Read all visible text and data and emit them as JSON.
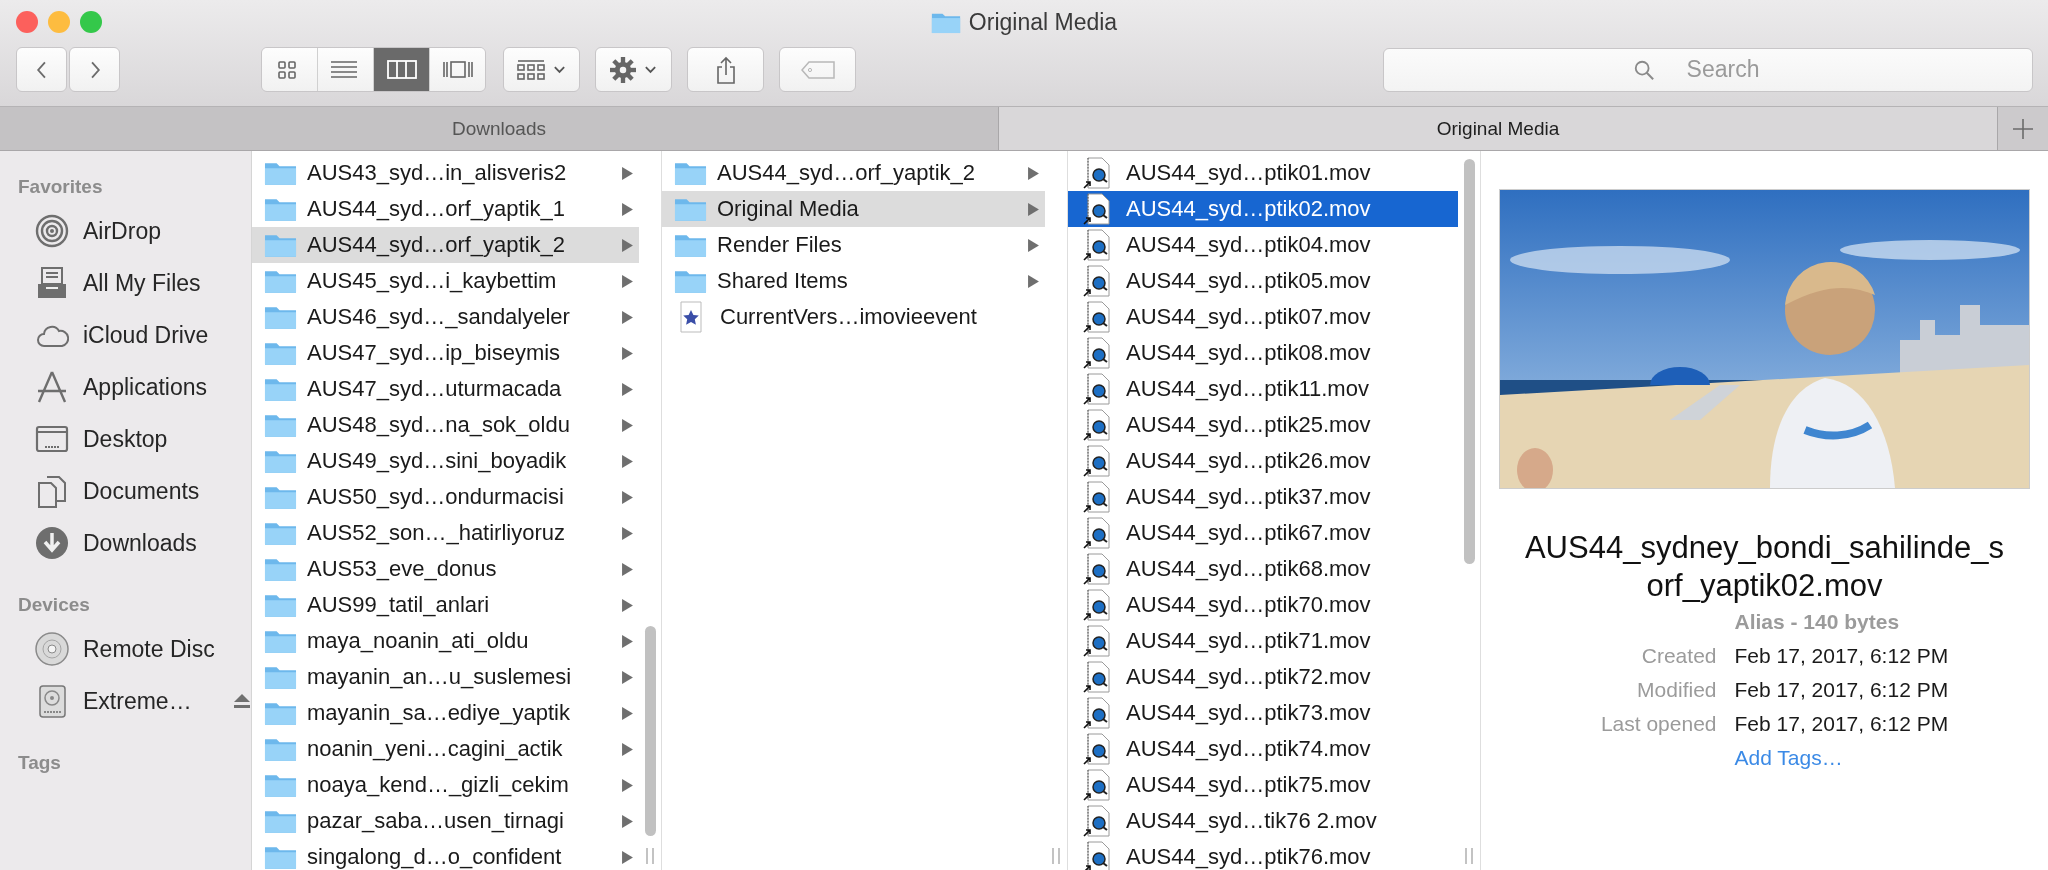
{
  "window": {
    "title": "Original Media"
  },
  "toolbar": {
    "navigation": [
      {
        "kind": "back"
      },
      {
        "kind": "forward"
      }
    ],
    "view_modes": [
      {
        "kind": "icons",
        "selected": false
      },
      {
        "kind": "list",
        "selected": false
      },
      {
        "kind": "columns",
        "selected": true
      },
      {
        "kind": "gallery",
        "selected": false
      }
    ],
    "buttons": [
      {
        "kind": "arrange",
        "disabled": false
      },
      {
        "kind": "action",
        "disabled": false
      },
      {
        "kind": "share",
        "disabled": false
      },
      {
        "kind": "tags",
        "disabled": true
      }
    ]
  },
  "search": {
    "placeholder": "Search"
  },
  "tabs": [
    {
      "label": "Downloads",
      "selected": false
    },
    {
      "label": "Original Media",
      "selected": true
    }
  ],
  "sidebar": {
    "sections": [
      {
        "heading": "Favorites",
        "items": [
          {
            "label": "AirDrop",
            "kind": "airdrop"
          },
          {
            "label": "All My Files",
            "kind": "files"
          },
          {
            "label": "iCloud Drive",
            "kind": "cloud"
          },
          {
            "label": "Applications",
            "kind": "applications"
          },
          {
            "label": "Desktop",
            "kind": "desktop"
          },
          {
            "label": "Documents",
            "kind": "documents"
          },
          {
            "label": "Downloads",
            "kind": "downloads"
          }
        ]
      },
      {
        "heading": "Devices",
        "items": [
          {
            "label": "Remote Disc",
            "kind": "disc",
            "eject": false
          },
          {
            "label": "Extreme…",
            "kind": "drive",
            "eject": true
          }
        ]
      },
      {
        "heading": "Tags"
      }
    ]
  },
  "columns": [
    {
      "focused": false,
      "items": [
        {
          "name": "AUS43_syd…in_alisveris2",
          "kind": "folder",
          "selected": false
        },
        {
          "name": "AUS44_syd…orf_yaptik_1",
          "kind": "folder",
          "selected": false
        },
        {
          "name": "AUS44_syd…orf_yaptik_2",
          "kind": "folder",
          "selected": true
        },
        {
          "name": "AUS45_syd…i_kaybettim",
          "kind": "folder",
          "selected": false
        },
        {
          "name": "AUS46_syd…_sandalyeler",
          "kind": "folder",
          "selected": false
        },
        {
          "name": "AUS47_syd…ip_biseymis",
          "kind": "folder",
          "selected": false
        },
        {
          "name": "AUS47_syd…uturmacada",
          "kind": "folder",
          "selected": false
        },
        {
          "name": "AUS48_syd…na_sok_oldu",
          "kind": "folder",
          "selected": false
        },
        {
          "name": "AUS49_syd…sini_boyadik",
          "kind": "folder",
          "selected": false
        },
        {
          "name": "AUS50_syd…ondurmacisi",
          "kind": "folder",
          "selected": false
        },
        {
          "name": "AUS52_son…_hatirliyoruz",
          "kind": "folder",
          "selected": false
        },
        {
          "name": "AUS53_eve_donus",
          "kind": "folder",
          "selected": false
        },
        {
          "name": "AUS99_tatil_anlari",
          "kind": "folder",
          "selected": false
        },
        {
          "name": "maya_noanin_ati_oldu",
          "kind": "folder",
          "selected": false
        },
        {
          "name": "mayanin_an…u_suslemesi",
          "kind": "folder",
          "selected": false
        },
        {
          "name": "mayanin_sa…ediye_yaptik",
          "kind": "folder",
          "selected": false
        },
        {
          "name": "noanin_yeni…cagini_actik",
          "kind": "folder",
          "selected": false
        },
        {
          "name": "noaya_kend…_gizli_cekim",
          "kind": "folder",
          "selected": false
        },
        {
          "name": "pazar_saba…usen_tirnagi",
          "kind": "folder",
          "selected": false
        },
        {
          "name": "singalong_d…o_confident",
          "kind": "folder",
          "selected": false
        }
      ]
    },
    {
      "focused": false,
      "items": [
        {
          "name": "AUS44_syd…orf_yaptik_2",
          "kind": "folder",
          "selected": false
        },
        {
          "name": "Original Media",
          "kind": "folder",
          "selected": true
        },
        {
          "name": "Render Files",
          "kind": "folder",
          "selected": false
        },
        {
          "name": "Shared Items",
          "kind": "folder",
          "selected": false
        },
        {
          "name": "CurrentVers…imovieevent",
          "kind": "event",
          "selected": false
        }
      ]
    },
    {
      "focused": true,
      "items": [
        {
          "name": "AUS44_syd…ptik01.mov",
          "kind": "movie",
          "selected": false
        },
        {
          "name": "AUS44_syd…ptik02.mov",
          "kind": "movie",
          "selected": true
        },
        {
          "name": "AUS44_syd…ptik04.mov",
          "kind": "movie",
          "selected": false
        },
        {
          "name": "AUS44_syd…ptik05.mov",
          "kind": "movie",
          "selected": false
        },
        {
          "name": "AUS44_syd…ptik07.mov",
          "kind": "movie",
          "selected": false
        },
        {
          "name": "AUS44_syd…ptik08.mov",
          "kind": "movie",
          "selected": false
        },
        {
          "name": "AUS44_syd…ptik11.mov",
          "kind": "movie",
          "selected": false
        },
        {
          "name": "AUS44_syd…ptik25.mov",
          "kind": "movie",
          "selected": false
        },
        {
          "name": "AUS44_syd…ptik26.mov",
          "kind": "movie",
          "selected": false
        },
        {
          "name": "AUS44_syd…ptik37.mov",
          "kind": "movie",
          "selected": false
        },
        {
          "name": "AUS44_syd…ptik67.mov",
          "kind": "movie",
          "selected": false
        },
        {
          "name": "AUS44_syd…ptik68.mov",
          "kind": "movie",
          "selected": false
        },
        {
          "name": "AUS44_syd…ptik70.mov",
          "kind": "movie",
          "selected": false
        },
        {
          "name": "AUS44_syd…ptik71.mov",
          "kind": "movie",
          "selected": false
        },
        {
          "name": "AUS44_syd…ptik72.mov",
          "kind": "movie",
          "selected": false
        },
        {
          "name": "AUS44_syd…ptik73.mov",
          "kind": "movie",
          "selected": false
        },
        {
          "name": "AUS44_syd…ptik74.mov",
          "kind": "movie",
          "selected": false
        },
        {
          "name": "AUS44_syd…ptik75.mov",
          "kind": "movie",
          "selected": false
        },
        {
          "name": "AUS44_syd…tik76 2.mov",
          "kind": "movie",
          "selected": false
        },
        {
          "name": "AUS44_syd…ptik76.mov",
          "kind": "movie",
          "selected": false
        }
      ]
    }
  ],
  "preview": {
    "file_name": "AUS44_sydney_bondi_sahilinde_sorf_yaptik02.mov",
    "kind_size": "Alias - 140 bytes",
    "fields": [
      {
        "label": "Created",
        "value": "Feb 17, 2017, 6:12 PM"
      },
      {
        "label": "Modified",
        "value": "Feb 17, 2017, 6:12 PM"
      },
      {
        "label": "Last opened",
        "value": "Feb 17, 2017, 6:12 PM"
      }
    ],
    "add_tags": "Add Tags…"
  }
}
